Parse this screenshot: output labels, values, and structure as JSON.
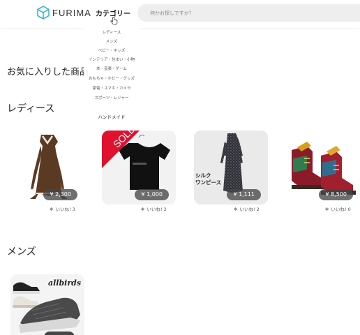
{
  "header": {
    "logo_text": "FURIMA",
    "category_label": "カテゴリー",
    "search_placeholder": "何かお探しですか？"
  },
  "category_menu": [
    "レディース",
    "メンズ",
    "ベビー・キッズ",
    "インテリア・住まい・小物",
    "本・音楽・ゲーム",
    "おもちゃ・ホビー・グッズ",
    "家電・スマホ・カメラ",
    "スポーツ・レジャー",
    "ハンドメイド"
  ],
  "favorites": {
    "title": "お気に入りした商品"
  },
  "ladies": {
    "title": "レディース",
    "items": [
      {
        "price": "¥ 2,300",
        "likes": "いいね! 3"
      },
      {
        "price": "¥ 1,000",
        "likes": "いいね! 2",
        "badge": "SOLD"
      },
      {
        "price": "¥ 1,111",
        "likes": "いいね! 2",
        "photo_text": "シルク\nワンピース"
      },
      {
        "price": "¥ 8,500",
        "likes": "いいね! 0"
      }
    ]
  },
  "mens": {
    "title": "メンズ",
    "items": [
      {
        "brand_text": "allbirds"
      }
    ]
  },
  "colors": {
    "sold_ribbon": "#e0102f",
    "price_bg": "#4a4a4a",
    "logo": "#3fb6c8"
  }
}
